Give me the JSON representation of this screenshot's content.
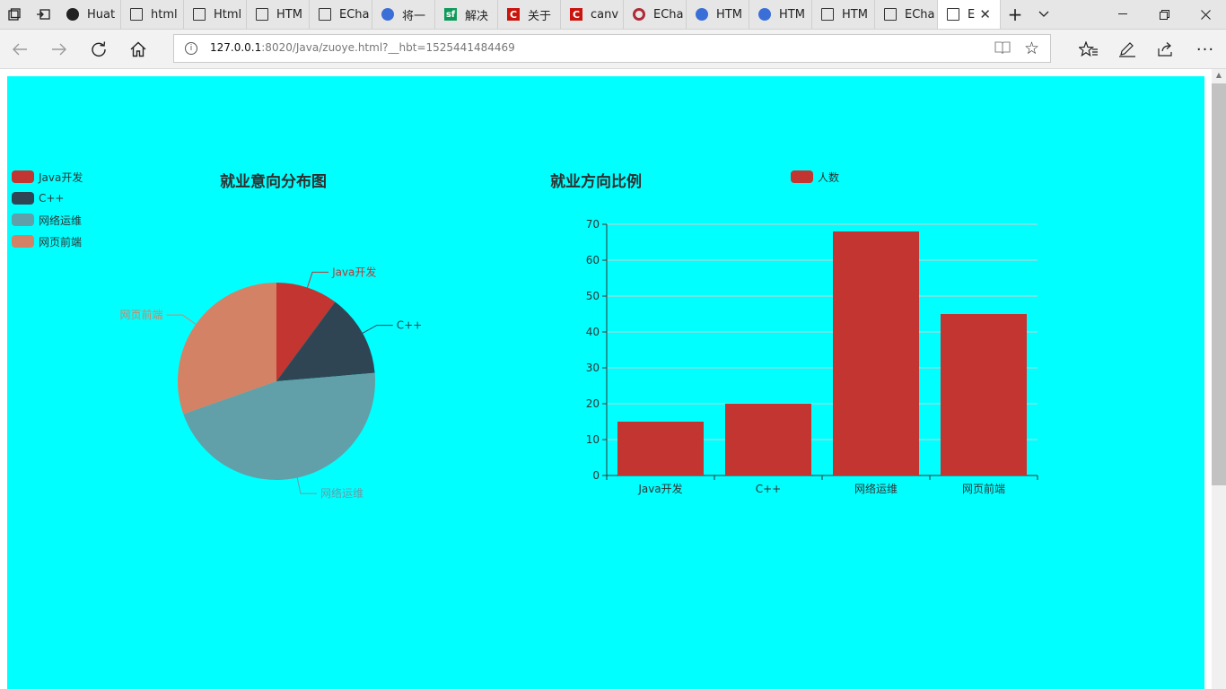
{
  "browser": {
    "tabs": [
      {
        "label": "Huat",
        "icon": "github-icon"
      },
      {
        "label": "html",
        "icon": "page-icon"
      },
      {
        "label": "Html",
        "icon": "page-icon"
      },
      {
        "label": "HTM",
        "icon": "page-icon"
      },
      {
        "label": "ECha",
        "icon": "page-icon"
      },
      {
        "label": "将一",
        "icon": "baidu-paw-icon"
      },
      {
        "label": "解决",
        "icon": "segmentfault-icon"
      },
      {
        "label": "关于",
        "icon": "csdn-icon"
      },
      {
        "label": "canv",
        "icon": "csdn-icon"
      },
      {
        "label": "ECha",
        "icon": "opera-ring-icon"
      },
      {
        "label": "HTM",
        "icon": "baidu-paw-icon"
      },
      {
        "label": "HTM",
        "icon": "baidu-paw-icon"
      },
      {
        "label": "HTM",
        "icon": "page-icon"
      },
      {
        "label": "ECha",
        "icon": "page-icon"
      },
      {
        "label": "E",
        "icon": "page-icon"
      }
    ],
    "sf_glyph": "sf",
    "csdn_glyph": "C",
    "address": {
      "host": "127.0.0.1",
      "path": ":8020/Java/zuoye.html?__hbt=1525441484469"
    }
  },
  "page": {
    "background_color": "#00ffff",
    "pie_legend": [
      {
        "label": "Java开发",
        "color": "#c23531"
      },
      {
        "label": "C++",
        "color": "#2f4554"
      },
      {
        "label": "网络运维",
        "color": "#61a0a8"
      },
      {
        "label": "网页前端",
        "color": "#d48265"
      }
    ],
    "bar_legend": {
      "label": "人数",
      "color": "#c23531"
    }
  },
  "chart_data": [
    {
      "type": "pie",
      "title": "就业意向分布图",
      "categories": [
        "Java开发",
        "C++",
        "网络运维",
        "网页前端"
      ],
      "values": [
        15,
        20,
        68,
        45
      ],
      "colors": [
        "#c23531",
        "#2f4554",
        "#61a0a8",
        "#d48265"
      ],
      "legend_position": "top-left"
    },
    {
      "type": "bar",
      "title": "就业方向比例",
      "categories": [
        "Java开发",
        "C++",
        "网络运维",
        "网页前端"
      ],
      "series": [
        {
          "name": "人数",
          "values": [
            15,
            20,
            68,
            45
          ]
        }
      ],
      "ylim": [
        0,
        70
      ],
      "yticks": [
        0,
        10,
        20,
        30,
        40,
        50,
        60,
        70
      ],
      "grid": true,
      "bar_color": "#c23531",
      "legend_position": "top-right"
    }
  ]
}
